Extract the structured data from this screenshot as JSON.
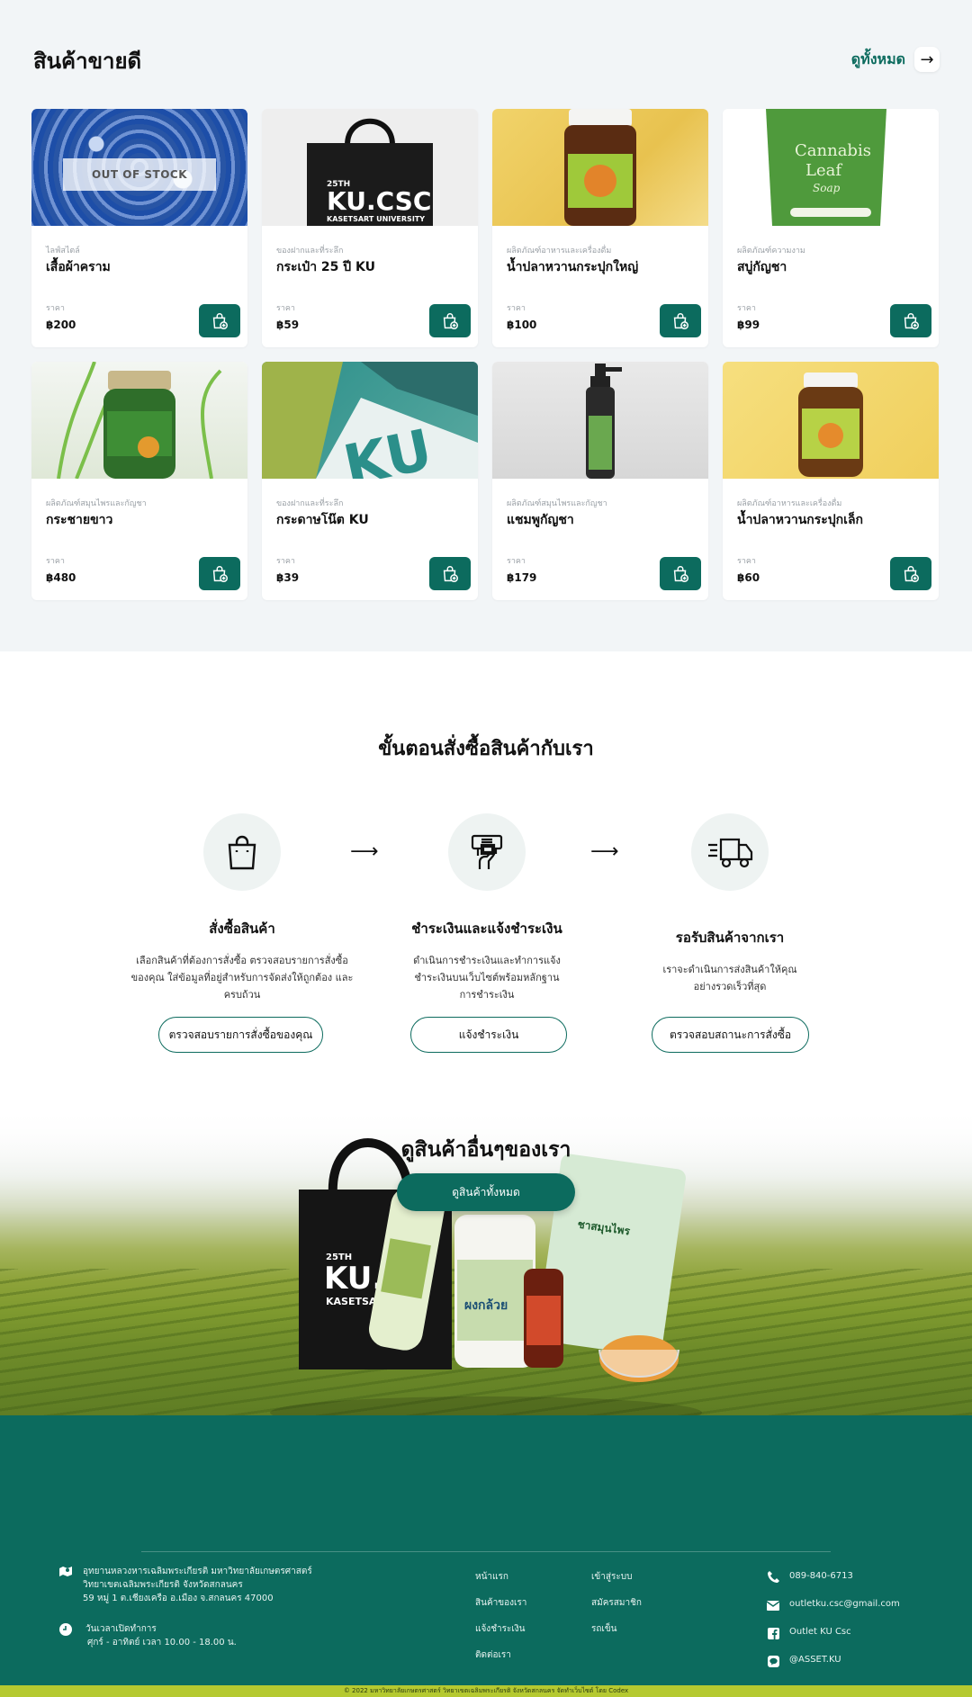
{
  "best_sellers": {
    "title": "สินค้าขายดี",
    "see_all": "ดูทั้งหมด",
    "out_of_stock": "OUT OF STOCK",
    "price_label": "ราคา",
    "products": [
      {
        "category": "ไลฟ์สไตล์",
        "name": "เสื้อผ้าคราม",
        "price": "฿200",
        "image_icon": "tie-dye-shirt-image",
        "out_of_stock": true
      },
      {
        "category": "ของฝากและที่ระลึก",
        "name": "กระเป๋า 25 ปี KU",
        "price": "฿59",
        "image_icon": "tote-bag-image",
        "image_text": [
          "25TH",
          "KU.CSC",
          "KASETSART UNIVERSITY"
        ]
      },
      {
        "category": "ผลิตภัณฑ์อาหารและเครื่องดื่ม",
        "name": "น้ำปลาหวานกระปุกใหญ่",
        "price": "฿100",
        "image_icon": "sauce-jar-image"
      },
      {
        "category": "ผลิตภัณฑ์ความงาม",
        "name": "สบู่กัญชา",
        "price": "฿99",
        "image_icon": "cannabis-soap-image",
        "image_text": [
          "Cannabis",
          "Leaf",
          "Soap"
        ]
      },
      {
        "category": "ผลิตภัณฑ์สมุนไพรและกัญชา",
        "name": "กระชายขาว",
        "price": "฿480",
        "image_icon": "herb-bottle-image"
      },
      {
        "category": "ของฝากและที่ระลึก",
        "name": "กระดาษโน๊ต KU",
        "price": "฿39",
        "image_icon": "note-paper-image",
        "image_text": [
          "KU"
        ]
      },
      {
        "category": "ผลิตภัณฑ์สมุนไพรและกัญชา",
        "name": "แชมพูกัญชา",
        "price": "฿179",
        "image_icon": "shampoo-bottle-image"
      },
      {
        "category": "ผลิตภัณฑ์อาหารและเครื่องดื่ม",
        "name": "น้ำปลาหวานกระปุกเล็ก",
        "price": "฿60",
        "image_icon": "small-sauce-jar-image"
      }
    ]
  },
  "steps": {
    "title": "ขั้นตอนสั่งซื้อสินค้ากับเรา",
    "items": [
      {
        "icon": "shopping-bag-icon",
        "title": "สั่งซื้อสินค้า",
        "desc": "เลือกสินค้าที่ต้องการสั่งซื้อ ตรวจสอบรายการสั่งซื้อของคุณ ใส่ข้อมูลที่อยู่สำหรับการจัดส่งให้ถูกต้อง และครบถ้วน",
        "button": "ตรวจสอบรายการสั่งซื้อของคุณ"
      },
      {
        "icon": "payment-icon",
        "title": "ชำระเงินและแจ้งชำระเงิน",
        "desc": "ดำเนินการชำระเงินและทำการแจ้งชำระเงินบนเว็บไซต์พร้อมหลักฐานการชำระเงิน",
        "button": "แจ้งชำระเงิน"
      },
      {
        "icon": "delivery-truck-icon",
        "title": "รอรับสินค้าจากเรา",
        "desc": "เราจะดำเนินการส่งสินค้าให้คุณอย่างรวดเร็วที่สุด",
        "button": "ตรวจสอบสถานะการสั่งซื้อ"
      }
    ]
  },
  "banner": {
    "title": "ดูสินค้าอื่นๆของเรา",
    "button": "ดูสินค้าทั้งหมด",
    "bag_text": [
      "25TH",
      "KU.C",
      "KASETSART"
    ],
    "label_text": [
      "ผงกล้วย",
      "ชาสมุนไพร"
    ]
  },
  "footer": {
    "address_lines": [
      "อุทยานหลวงหารเฉลิมพระเกียรติ มหาวิทยาลัยเกษตรศาสตร์",
      "วิทยาเขตเฉลิมพระเกียรติ จังหวัดสกลนคร",
      "59 หมู่ 1 ต.เชียงเครือ อ.เมือง จ.สกลนคร 47000"
    ],
    "hours_title": "วันเวลาเปิดทำการ",
    "hours": "ศุกร์ - อาทิตย์ เวลา 10.00 - 18.00 น.",
    "links_col1": [
      "หน้าแรก",
      "สินค้าของเรา",
      "แจ้งชำระเงิน",
      "ติดต่อเรา"
    ],
    "links_col2": [
      "เข้าสู่ระบบ",
      "สมัครสมาชิก",
      "รถเข็น"
    ],
    "phone": "089-840-6713",
    "email": "outletku.csc@gmail.com",
    "facebook": "Outlet KU Csc",
    "line": "@ASSET.KU",
    "copyright": "© 2022 มหาวิทยาลัยเกษตรศาสตร์ วิทยาเขตเฉลิมพระเกียรติ จังหวัดสกลนคร จัดทำเว็บไซต์ โดย Codex"
  },
  "colors": {
    "primary": "#0c6b5e",
    "accent": "#b5c930",
    "section_bg": "#f2f5f7"
  }
}
